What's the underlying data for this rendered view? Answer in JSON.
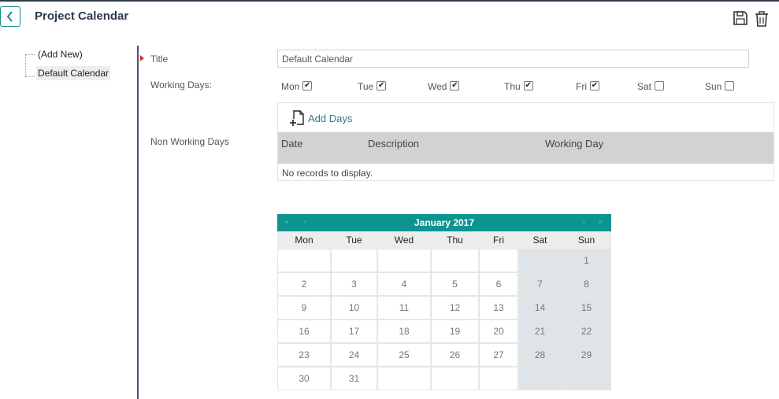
{
  "header": {
    "title": "Project Calendar",
    "back_icon": "chevron-left-icon",
    "save_icon": "save-icon",
    "delete_icon": "trash-icon"
  },
  "tree": {
    "items": [
      {
        "label": "(Add New)",
        "selected": false
      },
      {
        "label": "Default Calendar",
        "selected": true
      }
    ]
  },
  "form": {
    "title_label": "Title",
    "title_value": "Default Calendar",
    "working_days_label": "Working Days:",
    "working_days": [
      {
        "name": "Mon",
        "checked": true
      },
      {
        "name": "Tue",
        "checked": true
      },
      {
        "name": "Wed",
        "checked": true
      },
      {
        "name": "Thu",
        "checked": true
      },
      {
        "name": "Fri",
        "checked": true
      },
      {
        "name": "Sat",
        "checked": false
      },
      {
        "name": "Sun",
        "checked": false
      }
    ],
    "non_working_days_label": "Non Working Days",
    "add_days_label": "Add Days",
    "grid": {
      "columns": [
        "Date",
        "Description",
        "Working Day"
      ],
      "empty_text": "No records to display."
    }
  },
  "calendar": {
    "month_title": "January 2017",
    "nav": {
      "first": "«",
      "prev": "‹",
      "next": "›",
      "last": "»"
    },
    "weekdays": [
      "Mon",
      "Tue",
      "Wed",
      "Thu",
      "Fri",
      "Sat",
      "Sun"
    ],
    "weeks": [
      [
        "",
        "",
        "",
        "",
        "",
        "",
        "1"
      ],
      [
        "2",
        "3",
        "4",
        "5",
        "6",
        "7",
        "8"
      ],
      [
        "9",
        "10",
        "11",
        "12",
        "13",
        "14",
        "15"
      ],
      [
        "16",
        "17",
        "18",
        "19",
        "20",
        "21",
        "22"
      ],
      [
        "23",
        "24",
        "25",
        "26",
        "27",
        "28",
        "29"
      ],
      [
        "30",
        "31",
        "",
        "",
        "",
        "",
        ""
      ]
    ]
  },
  "colors": {
    "accent": "#0e9490",
    "weekend_cell": "#dfe4e8",
    "required_marker": "#d6332b"
  }
}
